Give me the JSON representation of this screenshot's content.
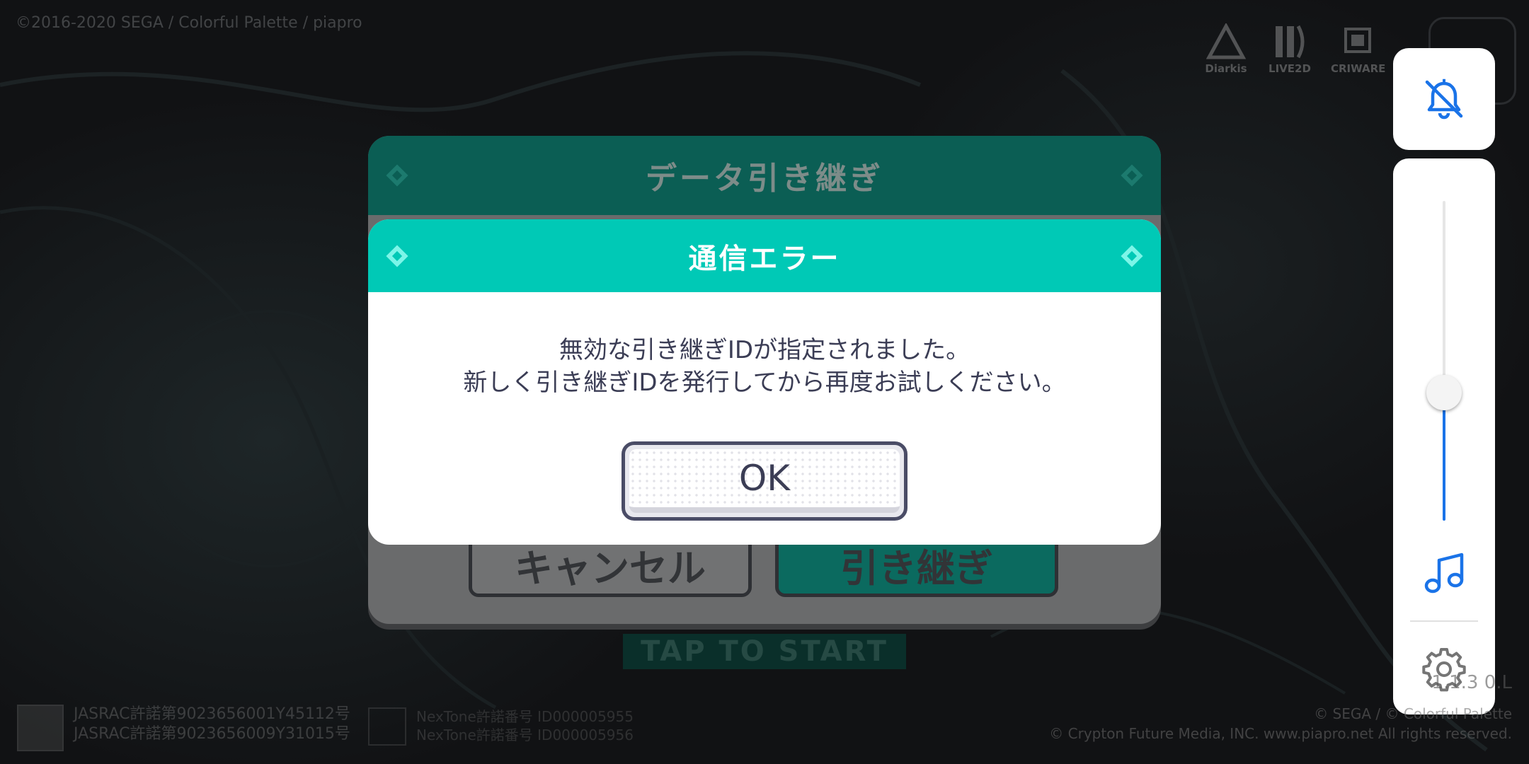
{
  "top_left_text": "©2016-2020 SEGA / Colorful Palette / piapro",
  "logos": [
    {
      "name": "Diarkis",
      "icon": "diarkis-logo"
    },
    {
      "name": "LIVE2D",
      "icon": "live2d-logo"
    },
    {
      "name": "CRIWARE",
      "icon": "criware-logo"
    }
  ],
  "background_dialog": {
    "title": "データ引き継ぎ",
    "cancel_label": "キャンセル",
    "confirm_label": "引き継ぎ"
  },
  "tap_to_start": "TAP TO START",
  "error_dialog": {
    "title": "通信エラー",
    "message_line1": "無効な引き継ぎIDが指定されました。",
    "message_line2": "新しく引き継ぎIDを発行してから再度お試しください。",
    "ok_label": "OK"
  },
  "side_panel": {
    "top_icon": "bell-off-icon",
    "volume_level": 0.4,
    "music_icon": "music-note-icon",
    "settings_icon": "gear-icon"
  },
  "footer": {
    "jasrac_line1": "JASRAC許諾第9023656001Y45112号",
    "jasrac_line2": "JASRAC許諾第9023656009Y31015号",
    "nextone_line1": "NexTone許諾番号 ID000005955",
    "nextone_line2": "NexTone許諾番号 ID000005956",
    "version": "1.1.3 0.L",
    "copyright_line1": "© SEGA / © Colorful Palette",
    "copyright_line2": "© Crypton Future Media, INC. www.piapro.net  All rights reserved."
  },
  "colors": {
    "dialog_header": "#00c9b6",
    "text": "#3b3d55",
    "accent": "#1a73e8"
  }
}
